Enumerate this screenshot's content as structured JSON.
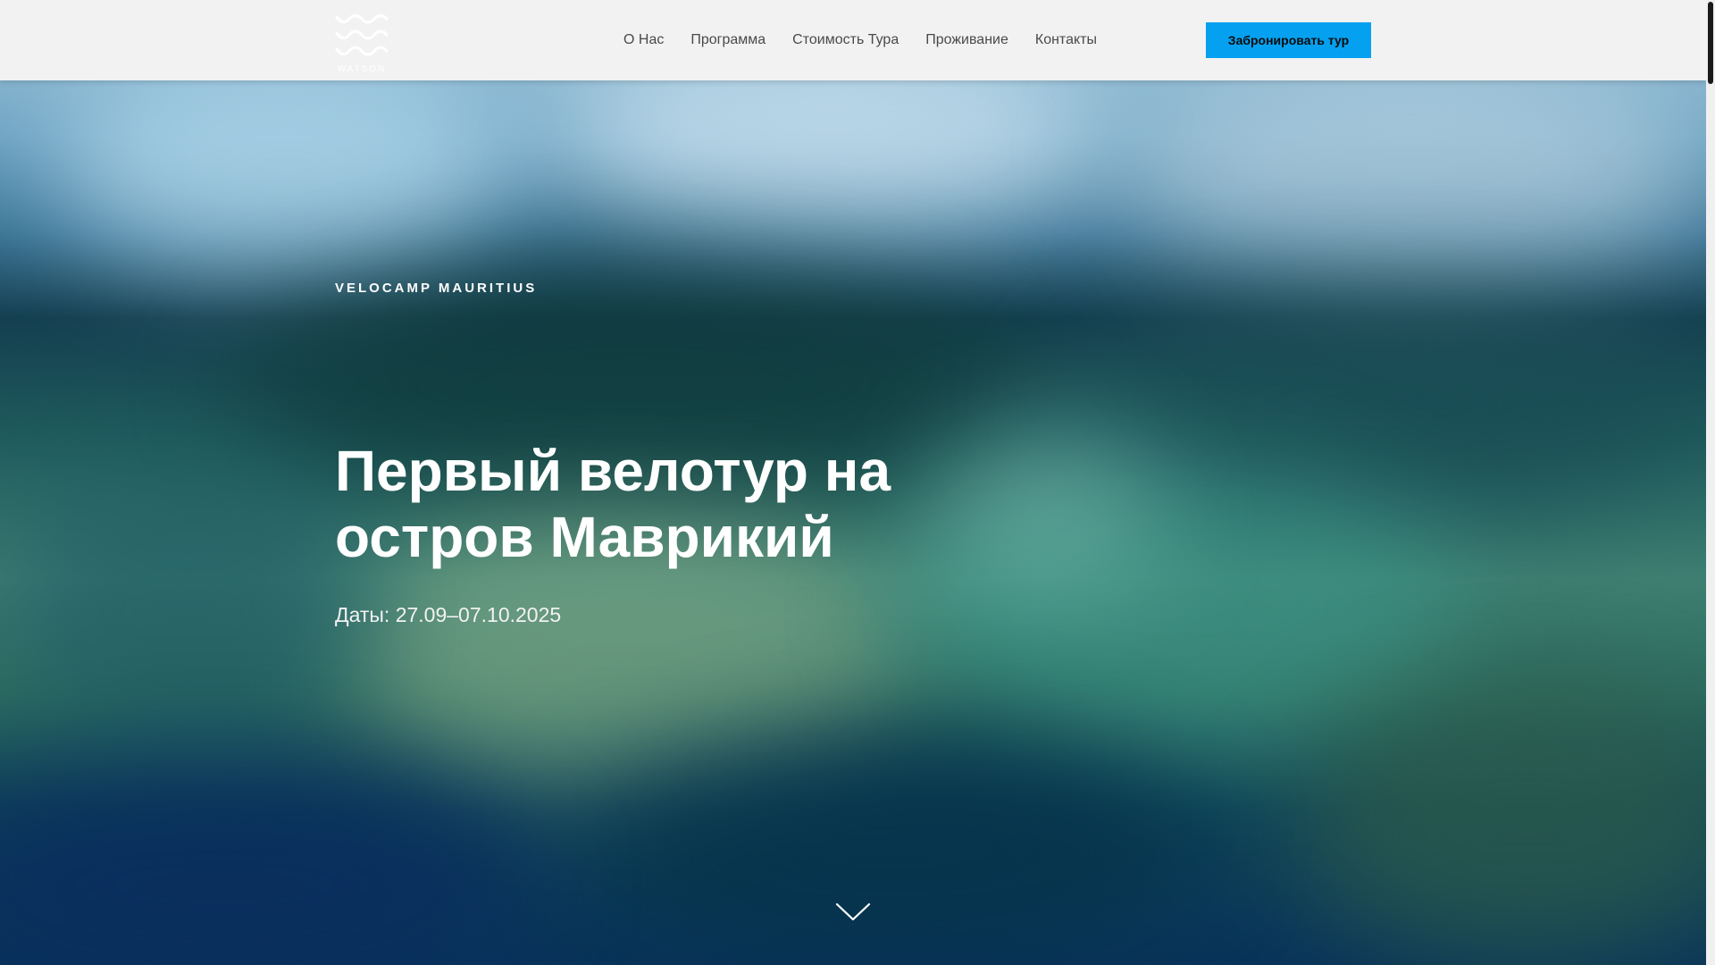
{
  "header": {
    "logo": {
      "icon": "waves-logo-icon",
      "text": "WATSON"
    },
    "nav": [
      {
        "label": "О Нас"
      },
      {
        "label": "Программа"
      },
      {
        "label": "Стоимость Тура"
      },
      {
        "label": "Проживание"
      },
      {
        "label": "Контакты"
      }
    ],
    "cta_label": "Забронировать тур"
  },
  "hero": {
    "eyebrow": "VELOCAMP MAURITIUS",
    "title": "Первый велотур на остров Маврикий",
    "dates": "Даты: 27.09–07.10.2025",
    "scroll_icon": "chevron-down-icon"
  },
  "colors": {
    "accent": "#05a1f0",
    "header_bg": "#f2f2f2",
    "nav_text": "#4a4a4a",
    "hero_text": "#ffffff"
  }
}
